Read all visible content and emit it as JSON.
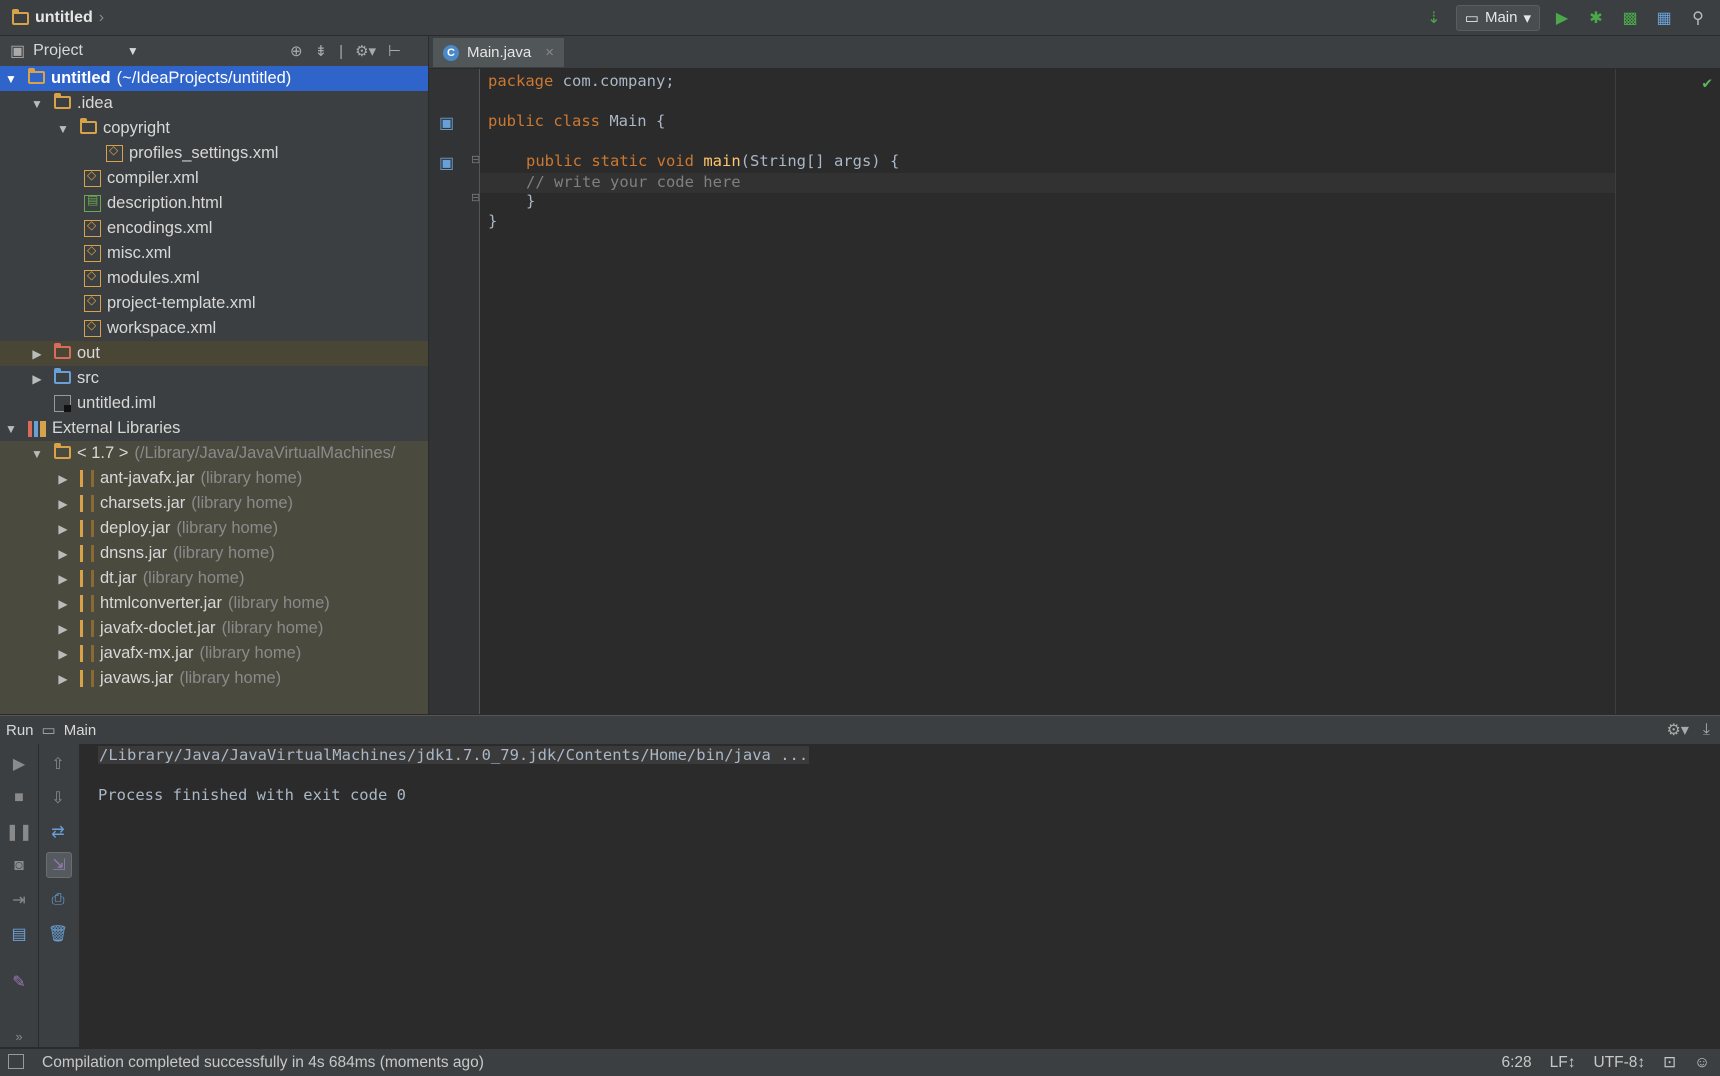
{
  "breadcrumb": {
    "project": "untitled"
  },
  "toolbar": {
    "run_config": "Main"
  },
  "project_panel": {
    "title": "Project",
    "tree": [
      {
        "label": "untitled",
        "path": "(~/IdeaProjects/untitled)"
      },
      {
        "label": ".idea"
      },
      {
        "label": "copyright"
      },
      {
        "label": "profiles_settings.xml"
      },
      {
        "label": "compiler.xml"
      },
      {
        "label": "description.html"
      },
      {
        "label": "encodings.xml"
      },
      {
        "label": "misc.xml"
      },
      {
        "label": "modules.xml"
      },
      {
        "label": "project-template.xml"
      },
      {
        "label": "workspace.xml"
      },
      {
        "label": "out"
      },
      {
        "label": "src"
      },
      {
        "label": "untitled.iml"
      },
      {
        "label": "External Libraries"
      },
      {
        "label": "< 1.7 >",
        "path": "(/Library/Java/JavaVirtualMachines/"
      }
    ],
    "jars": [
      "ant-javafx.jar",
      "charsets.jar",
      "deploy.jar",
      "dnsns.jar",
      "dt.jar",
      "htmlconverter.jar",
      "javafx-doclet.jar",
      "javafx-mx.jar",
      "javaws.jar"
    ],
    "jar_suffix": "(library home)"
  },
  "editor": {
    "tab": "Main.java",
    "code": {
      "l1_kw": "package",
      "l1_rest": " com.company;",
      "l3_kw": "public class",
      "l3_rest": " Main {",
      "l5_kw": "public static void",
      "l5_fn": "main",
      "l5_rest": "(String[] args) {",
      "l6_cm": "// write your code here",
      "l7": "}",
      "l8": "}"
    }
  },
  "run_panel": {
    "label": "Run",
    "config": "Main",
    "command": "/Library/Java/JavaVirtualMachines/jdk1.7.0_79.jdk/Contents/Home/bin/java ...",
    "output": "Process finished with exit code 0"
  },
  "status": {
    "message": "Compilation completed successfully in 4s 684ms (moments ago)",
    "position": "6:28",
    "line_sep": "LF↕",
    "encoding": "UTF-8↕"
  }
}
